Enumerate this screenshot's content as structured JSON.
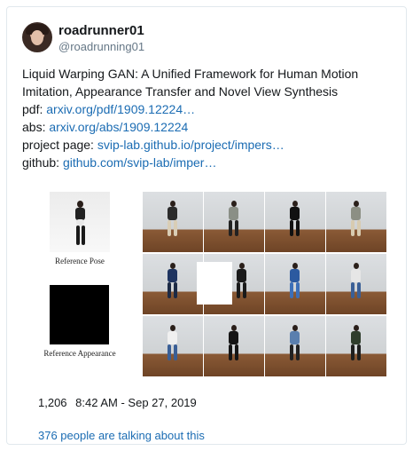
{
  "author": {
    "display_name": "roadrunner01",
    "handle": "@roadrunning01"
  },
  "tweet": {
    "title_line1": "Liquid Warping GAN: A Unified Framework for Human Motion",
    "title_line2": "Imitation, Appearance Transfer and Novel View Synthesis",
    "pdf_label": "pdf: ",
    "pdf_link": "arxiv.org/pdf/1909.12224…",
    "abs_label": "abs: ",
    "abs_link": "arxiv.org/abs/1909.12224",
    "project_label": "project page: ",
    "project_link": "svip-lab.github.io/project/impers…",
    "github_label": "github: ",
    "github_link": "github.com/svip-lab/imper…"
  },
  "figure": {
    "reference_pose_caption": "Reference Pose",
    "reference_appearance_caption": "Reference Appearance"
  },
  "footer": {
    "likes": "1,206",
    "timestamp": "8:42 AM - Sep 27, 2019",
    "talking": "376 people are talking about this"
  },
  "colors": {
    "link": "#1b6cb3",
    "text": "#14171a",
    "muted": "#657786",
    "border": "#e1e8ed"
  }
}
